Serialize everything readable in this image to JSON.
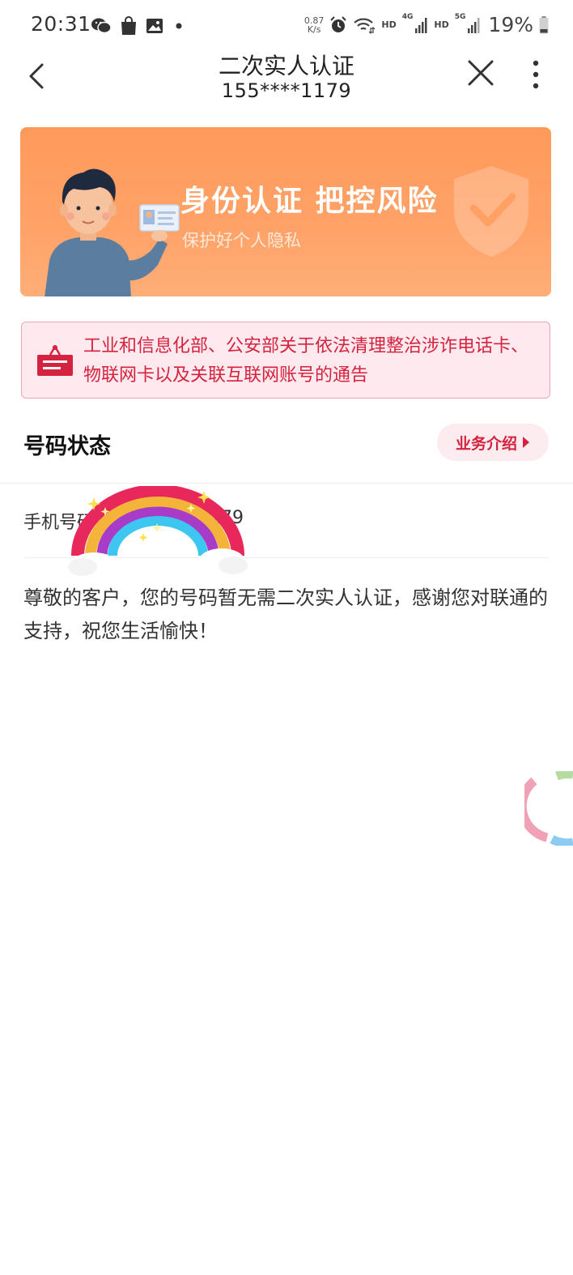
{
  "status_bar": {
    "time": "20:31",
    "network_speed_value": "0.87",
    "network_speed_unit": "K/s",
    "hd1": "HD",
    "net1": "4G",
    "hd2": "HD",
    "net2": "5G",
    "battery": "19%",
    "left_icons": [
      "wechat-icon",
      "shopping-bag-icon",
      "gallery-icon",
      "dot-icon"
    ],
    "right_icons": [
      "alarm-icon",
      "wifi-icon",
      "signal-icon",
      "signal-icon",
      "battery-icon"
    ]
  },
  "nav": {
    "title": "二次实人认证",
    "subtitle": "155****1179"
  },
  "banner": {
    "title": "身份认证 把控风险",
    "subtitle": "保护好个人隐私"
  },
  "notice": {
    "text": "工业和信息化部、公安部关于依法清理整治涉诈电话卡、物联网卡以及关联互联网账号的通告"
  },
  "section": {
    "title": "号码状态",
    "intro_button": "业务介绍"
  },
  "phone": {
    "label": "手机号码",
    "value": "179"
  },
  "message": "尊敬的客户，您的号码暂无需二次实人认证，感谢您对联通的支持，祝您生活愉快！",
  "colors": {
    "brand_red": "#d4223f",
    "banner_orange": "#ff9a5a",
    "notice_bg": "#fde9ee"
  }
}
